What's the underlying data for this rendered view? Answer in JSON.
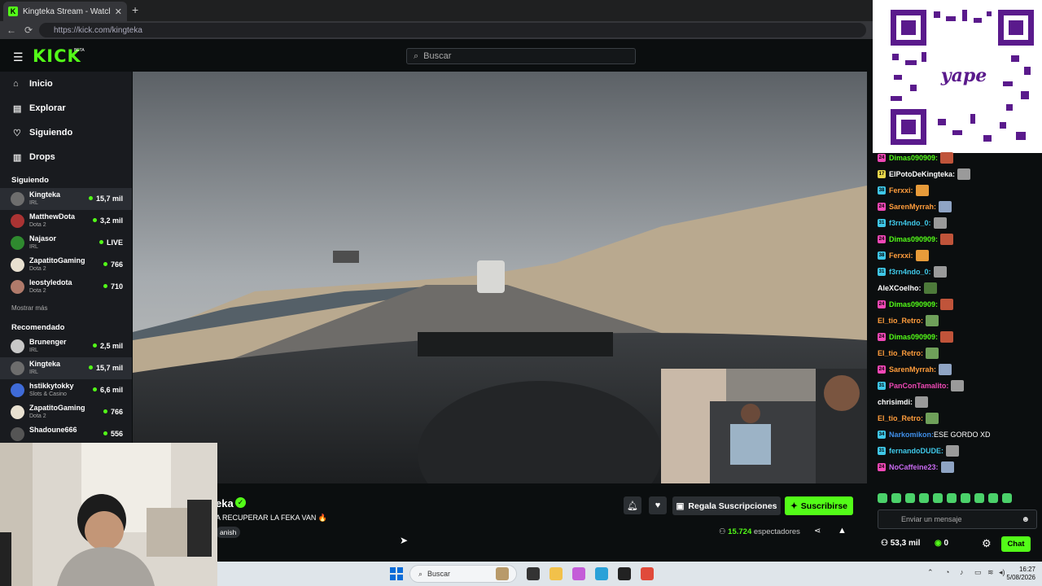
{
  "browser": {
    "tab_title": "Kingteka Stream - Watch Live on Kick",
    "tab_favicon": "K",
    "url": "https://kick.com/kingteka",
    "new_tab": "+",
    "close": "✕"
  },
  "header": {
    "logo": "KICK",
    "beta": "BETA",
    "search_placeholder": "Buscar"
  },
  "sidebar": {
    "nav": [
      {
        "label": "Inicio",
        "icon": "home-icon"
      },
      {
        "label": "Explorar",
        "icon": "compass-icon"
      },
      {
        "label": "Siguiendo",
        "icon": "heart-icon"
      },
      {
        "label": "Drops",
        "icon": "drops-icon"
      }
    ],
    "following_header": "Siguiendo",
    "following": [
      {
        "name": "Kingteka",
        "category": "IRL",
        "viewers": "15,7 mil",
        "active": true
      },
      {
        "name": "MatthewDota",
        "category": "Dota 2",
        "viewers": "3,2 mil"
      },
      {
        "name": "Najasor",
        "category": "IRL",
        "viewers": "LIVE"
      },
      {
        "name": "ZapatitoGaming",
        "category": "Dota 2",
        "viewers": "766"
      },
      {
        "name": "leostyledota",
        "category": "Dota 2",
        "viewers": "710"
      }
    ],
    "show_more": "Mostrar más",
    "recommended_header": "Recomendado",
    "recommended": [
      {
        "name": "Brunenger",
        "category": "IRL",
        "viewers": "2,5 mil"
      },
      {
        "name": "Kingteka",
        "category": "IRL",
        "viewers": "15,7 mil",
        "active": true
      },
      {
        "name": "hstikkytokky",
        "category": "Slots & Casino",
        "viewers": "6,6 mil"
      },
      {
        "name": "ZapatitoGaming",
        "category": "Dota 2",
        "viewers": "766"
      },
      {
        "name": "Shadoune666",
        "category": "",
        "viewers": "556"
      }
    ]
  },
  "stream": {
    "streamer_name": "eka",
    "title": "A RECUPERAR LA FEKA VAN 🔥",
    "language": "anish",
    "viewer_count": "15.724",
    "viewer_label": "espectadores",
    "gift_label": "Regala Suscripciones",
    "subscribe_label": "Suscribirse"
  },
  "chat": {
    "messages": [
      {
        "badge": "24",
        "badge_color": "#f048b6",
        "user": "Dimas090909:",
        "user_color": "#53fc18",
        "text": "",
        "emote": "#c0543a"
      },
      {
        "badge": "17",
        "badge_color": "#e8d64a",
        "user": "ElPotoDeKingteka:",
        "user_color": "#ffffff",
        "text": "",
        "emote": "#9a9a9a"
      },
      {
        "badge": "38",
        "badge_color": "#3fc8e8",
        "user": "Ferxxi:",
        "user_color": "#ff9d3c",
        "text": "",
        "emote": "#e79b3a"
      },
      {
        "badge": "24",
        "badge_color": "#f048b6",
        "user": "SarenMyrrah:",
        "user_color": "#ff9d3c",
        "text": "",
        "emote": "#8fa4c4"
      },
      {
        "badge": "31",
        "badge_color": "#3fc8e8",
        "user": "f3rn4ndo_0:",
        "user_color": "#3fc8e8",
        "text": "",
        "emote": "#9a9a9a"
      },
      {
        "badge": "24",
        "badge_color": "#f048b6",
        "user": "Dimas090909:",
        "user_color": "#53fc18",
        "text": "",
        "emote": "#c0543a"
      },
      {
        "badge": "38",
        "badge_color": "#3fc8e8",
        "user": "Ferxxi:",
        "user_color": "#ff9d3c",
        "text": "",
        "emote": "#e79b3a"
      },
      {
        "badge": "31",
        "badge_color": "#3fc8e8",
        "user": "f3rn4ndo_0:",
        "user_color": "#3fc8e8",
        "text": "",
        "emote": "#9a9a9a"
      },
      {
        "badge": "",
        "badge_color": "",
        "user": "AleXCoelho:",
        "user_color": "#ffffff",
        "text": "",
        "emote": "#4d7a3a"
      },
      {
        "badge": "24",
        "badge_color": "#f048b6",
        "user": "Dimas090909:",
        "user_color": "#53fc18",
        "text": "",
        "emote": "#c0543a"
      },
      {
        "badge": "",
        "badge_color": "",
        "user": "El_tio_Retro:",
        "user_color": "#ff9d3c",
        "text": "",
        "emote": "#6fa05a"
      },
      {
        "badge": "24",
        "badge_color": "#f048b6",
        "user": "Dimas090909:",
        "user_color": "#53fc18",
        "text": "",
        "emote": "#c0543a"
      },
      {
        "badge": "",
        "badge_color": "",
        "user": "El_tio_Retro:",
        "user_color": "#ff9d3c",
        "text": "",
        "emote": "#6fa05a"
      },
      {
        "badge": "24",
        "badge_color": "#f048b6",
        "user": "SarenMyrrah:",
        "user_color": "#ff9d3c",
        "text": "",
        "emote": "#8fa4c4"
      },
      {
        "badge": "31",
        "badge_color": "#3fc8e8",
        "user": "PanConTamalito:",
        "user_color": "#f048b6",
        "text": "",
        "emote": "#9a9a9a"
      },
      {
        "badge": "",
        "badge_color": "",
        "user": "chrisimdi:",
        "user_color": "#ffffff",
        "text": "",
        "emote": "#9a9a9a"
      },
      {
        "badge": "",
        "badge_color": "",
        "user": "El_tio_Retro:",
        "user_color": "#ff9d3c",
        "text": "",
        "emote": "#6fa05a"
      },
      {
        "badge": "34",
        "badge_color": "#3fc8e8",
        "user": "Narkomikon:",
        "user_color": "#3f8ee8",
        "text": " ESE GORDO XD",
        "emote": ""
      },
      {
        "badge": "31",
        "badge_color": "#3fc8e8",
        "user": "fernandoDUDE:",
        "user_color": "#3fc8e8",
        "text": "",
        "emote": "#9a9a9a"
      },
      {
        "badge": "24",
        "badge_color": "#f048b6",
        "user": "NoCaffeine23:",
        "user_color": "#c86af0",
        "text": "",
        "emote": "#8fa4c4"
      }
    ],
    "input_placeholder": "Enviar un mensaje",
    "points": "53,3 mil",
    "kick_coins": "0",
    "chat_button": "Chat"
  },
  "taskbar": {
    "search_placeholder": "Buscar",
    "time": "16:27",
    "date": "5/08/2026"
  },
  "colors": {
    "accent": "#53fc18",
    "bg": "#0b0e0f",
    "sidebar": "#191b1f"
  }
}
